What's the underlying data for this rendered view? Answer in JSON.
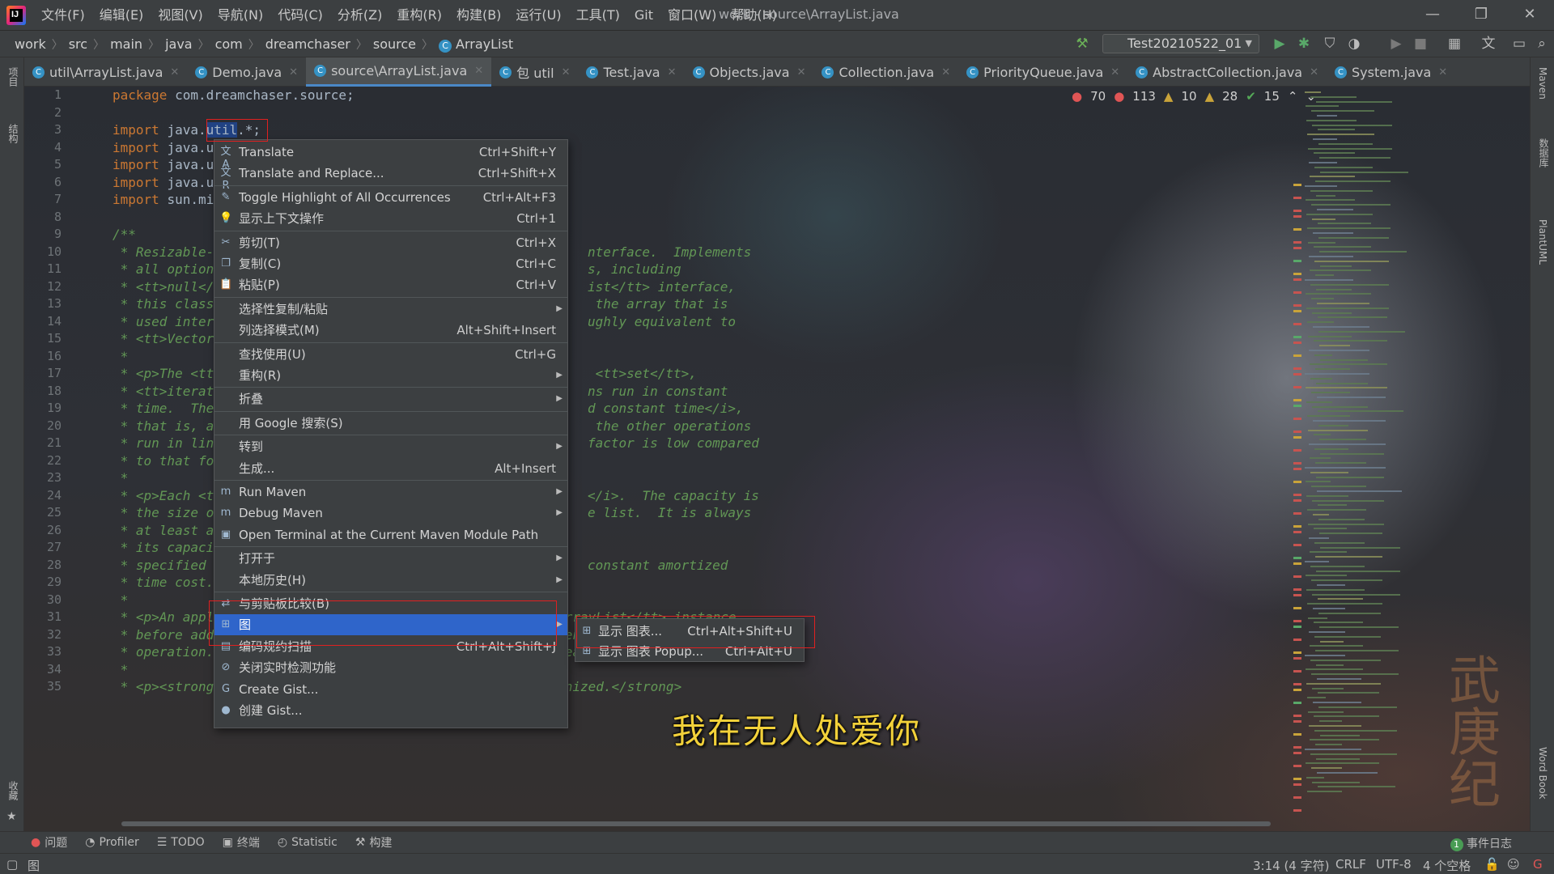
{
  "app": {
    "logo_text": "IJ",
    "window_title": "work - source\\ArrayList.java",
    "menu": [
      "文件(F)",
      "编辑(E)",
      "视图(V)",
      "导航(N)",
      "代码(C)",
      "分析(Z)",
      "重构(R)",
      "构建(B)",
      "运行(U)",
      "工具(T)",
      "Git",
      "窗口(W)",
      "帮助(H)"
    ],
    "window_controls": {
      "minimize": "—",
      "restore": "❐",
      "close": "✕"
    }
  },
  "breadcrumb": [
    "work",
    "src",
    "main",
    "java",
    "com",
    "dreamchaser",
    "source",
    "ArrayList"
  ],
  "run_config": "Test20210522_01",
  "tabs": [
    {
      "label": "util\\ArrayList.java",
      "active": false
    },
    {
      "label": "Demo.java",
      "active": false
    },
    {
      "label": "source\\ArrayList.java",
      "active": true
    },
    {
      "label": "包 util",
      "active": false
    },
    {
      "label": "Test.java",
      "active": false
    },
    {
      "label": "Objects.java",
      "active": false
    },
    {
      "label": "Collection.java",
      "active": false
    },
    {
      "label": "PriorityQueue.java",
      "active": false
    },
    {
      "label": "AbstractCollection.java",
      "active": false
    },
    {
      "label": "System.java",
      "active": false
    }
  ],
  "left_strip": [
    "项目",
    "结构",
    "收藏"
  ],
  "right_strip": [
    "Maven",
    "数据库",
    "PlantUML",
    "Word Book"
  ],
  "inspection": {
    "errors": "70",
    "errors2": "113",
    "warnings": "10",
    "weak_warnings": "28",
    "ok": "15"
  },
  "code_lines": [
    {
      "n": "1",
      "kw": "package ",
      "text": "com.dreamchaser.source;"
    },
    {
      "n": "2",
      "kw": "",
      "text": ""
    },
    {
      "n": "3",
      "kw": "import ",
      "text": "java.",
      "sel": "util",
      "tail": ".*;"
    },
    {
      "n": "4",
      "kw": "import ",
      "text": "java.u"
    },
    {
      "n": "5",
      "kw": "import ",
      "text": "java.u"
    },
    {
      "n": "6",
      "kw": "import ",
      "text": "java.u"
    },
    {
      "n": "7",
      "kw": "import ",
      "text": "sun.mi"
    },
    {
      "n": "8",
      "kw": "",
      "text": ""
    },
    {
      "n": "9",
      "doc": "/**"
    },
    {
      "n": "10",
      "doc": " * Resizable-",
      "doc2": "nterface.  Implements"
    },
    {
      "n": "11",
      "doc": " * all option",
      "doc2": "s, including"
    },
    {
      "n": "12",
      "doc": " * <tt>null</",
      "doc2": "ist</tt> interface,"
    },
    {
      "n": "13",
      "doc": " * this class",
      "doc2": " the array that is"
    },
    {
      "n": "14",
      "doc": " * used inter",
      "doc2": "ughly equivalent to"
    },
    {
      "n": "15",
      "doc": " * <tt>Vector",
      "doc2": ""
    },
    {
      "n": "16",
      "doc": " *",
      "doc2": ""
    },
    {
      "n": "17",
      "doc": " * <p>The <tt",
      "doc2": " <tt>set</tt>,"
    },
    {
      "n": "18",
      "doc": " * <tt>iterat",
      "doc2": "ns run in constant"
    },
    {
      "n": "19",
      "doc": " * time.  The",
      "doc2": "d constant time</i>,"
    },
    {
      "n": "20",
      "doc": " * that is, a",
      "doc2": " the other operations"
    },
    {
      "n": "21",
      "doc": " * run in lin",
      "doc2": "factor is low compared"
    },
    {
      "n": "22",
      "doc": " * to that fo",
      "doc2": ""
    },
    {
      "n": "23",
      "doc": " *",
      "doc2": ""
    },
    {
      "n": "24",
      "doc": " * <p>Each <t",
      "doc2": "</i>.  The capacity is"
    },
    {
      "n": "25",
      "doc": " * the size o",
      "doc2": "e list.  It is always"
    },
    {
      "n": "26",
      "doc": " * at least a",
      "doc2": ""
    },
    {
      "n": "27",
      "doc": " * its capaci",
      "doc2": ""
    },
    {
      "n": "28",
      "doc": " * specified ",
      "doc2": "constant amortized"
    },
    {
      "n": "29",
      "doc": " * time cost.",
      "doc2": ""
    },
    {
      "n": "30",
      "doc": " *",
      "doc2": ""
    },
    {
      "n": "31",
      "doc": " * <p>An application can increase the capacity of an <tt>ArrayList</tt> instance",
      "doc2": ""
    },
    {
      "n": "32",
      "doc": " * before adding a large number of elements using the <tt>ensureCapacity</tt>",
      "doc2": ""
    },
    {
      "n": "33",
      "doc": " * operation.  This may reduce the amount of incremental reallocation.",
      "doc2": ""
    },
    {
      "n": "34",
      "doc": " *",
      "doc2": ""
    },
    {
      "n": "35",
      "doc": " * <p><strong>Note that this implementation is not synchronized.</strong>",
      "doc2": ""
    }
  ],
  "context_menu": [
    {
      "icon": "translate-icon",
      "glyph": "文A",
      "label": "Translate",
      "shortcut": "Ctrl+Shift+Y"
    },
    {
      "icon": "translate-replace-icon",
      "glyph": "文R",
      "label": "Translate and Replace...",
      "shortcut": "Ctrl+Shift+X"
    },
    {
      "icon": "highlight-icon",
      "glyph": "✎",
      "label": "Toggle Highlight of All Occurrences",
      "shortcut": "Ctrl+Alt+F3"
    },
    {
      "icon": "bulb-icon",
      "glyph": "💡",
      "label": "显示上下文操作",
      "shortcut": "Ctrl+1"
    },
    {
      "icon": "scissors-icon",
      "glyph": "✂",
      "label": "剪切(T)",
      "shortcut": "Ctrl+X"
    },
    {
      "icon": "copy-icon",
      "glyph": "❐",
      "label": "复制(C)",
      "shortcut": "Ctrl+C"
    },
    {
      "icon": "paste-icon",
      "glyph": "📋",
      "label": "粘贴(P)",
      "shortcut": "Ctrl+V"
    },
    {
      "icon": "",
      "glyph": "",
      "label": "选择性复制/粘贴",
      "shortcut": "",
      "submenu": true
    },
    {
      "icon": "",
      "glyph": "",
      "label": "列选择模式(M)",
      "shortcut": "Alt+Shift+Insert"
    },
    {
      "icon": "",
      "glyph": "",
      "label": "查找使用(U)",
      "shortcut": "Ctrl+G"
    },
    {
      "icon": "",
      "glyph": "",
      "label": "重构(R)",
      "shortcut": "",
      "submenu": true
    },
    {
      "icon": "",
      "glyph": "",
      "label": "折叠",
      "shortcut": "",
      "submenu": true
    },
    {
      "icon": "",
      "glyph": "",
      "label": "用 Google 搜索(S)",
      "shortcut": ""
    },
    {
      "icon": "",
      "glyph": "",
      "label": "转到",
      "shortcut": "",
      "submenu": true
    },
    {
      "icon": "",
      "glyph": "",
      "label": "生成...",
      "shortcut": "Alt+Insert"
    },
    {
      "icon": "maven-run-icon",
      "glyph": "m",
      "label": "Run Maven",
      "shortcut": "",
      "submenu": true
    },
    {
      "icon": "maven-debug-icon",
      "glyph": "m",
      "label": "Debug Maven",
      "shortcut": "",
      "submenu": true
    },
    {
      "icon": "terminal-icon",
      "glyph": "▣",
      "label": "Open Terminal at the Current Maven Module Path",
      "shortcut": ""
    },
    {
      "icon": "",
      "glyph": "",
      "label": "打开于",
      "shortcut": "",
      "submenu": true
    },
    {
      "icon": "",
      "glyph": "",
      "label": "本地历史(H)",
      "shortcut": "",
      "submenu": true
    },
    {
      "icon": "compare-icon",
      "glyph": "⇄",
      "label": "与剪贴板比较(B)",
      "shortcut": ""
    },
    {
      "icon": "diagram-icon",
      "glyph": "⊞",
      "label": "图",
      "shortcut": "",
      "submenu": true,
      "selected": true
    },
    {
      "icon": "scan-icon",
      "glyph": "▤",
      "label": "编码规约扫描",
      "shortcut": "Ctrl+Alt+Shift+J"
    },
    {
      "icon": "disable-icon",
      "glyph": "⊘",
      "label": "关闭实时检测功能",
      "shortcut": ""
    },
    {
      "icon": "gist-icon",
      "glyph": "G",
      "label": "Create Gist...",
      "shortcut": ""
    },
    {
      "icon": "github-icon",
      "glyph": "●",
      "label": "创建 Gist...",
      "shortcut": ""
    }
  ],
  "submenu": [
    {
      "label": "显示 图表...",
      "shortcut": "Ctrl+Alt+Shift+U"
    },
    {
      "label": "显示 图表 Popup...",
      "shortcut": "Ctrl+Alt+U"
    }
  ],
  "subtitle": "我在无人处爱你",
  "watermark": "武庚纪",
  "bottom_tools": [
    {
      "icon": "problems-icon",
      "glyph": "●",
      "label": "问题"
    },
    {
      "icon": "profiler-icon",
      "glyph": "◔",
      "label": "Profiler"
    },
    {
      "icon": "todo-icon",
      "glyph": "☰",
      "label": "TODO"
    },
    {
      "icon": "terminal-icon",
      "glyph": "▣",
      "label": "终端"
    },
    {
      "icon": "statistic-icon",
      "glyph": "◴",
      "label": "Statistic"
    },
    {
      "icon": "build-icon",
      "glyph": "⚒",
      "label": "构建"
    }
  ],
  "event_log": {
    "count": "1",
    "label": "事件日志"
  },
  "status": {
    "left": "图",
    "position": "3:14 (4 字符)",
    "line_sep": "CRLF",
    "encoding": "UTF-8",
    "indent": "4 个空格"
  },
  "colors": {
    "accent": "#2f65ca",
    "keyword": "#cc7832",
    "doc": "#629755",
    "error": "#e05555"
  }
}
